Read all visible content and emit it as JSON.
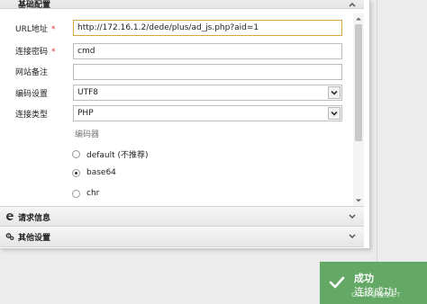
{
  "top_panel": {
    "title": "基础配置"
  },
  "form": {
    "url": {
      "label": "URL地址",
      "required_mark": "*",
      "value": "http://172.16.1.2/dede/plus/ad_js.php?aid=1"
    },
    "password": {
      "label": "连接密码",
      "required_mark": "*",
      "value": "cmd"
    },
    "remark": {
      "label": "网站备注",
      "value": ""
    },
    "encoding": {
      "label": "编码设置",
      "value": "UTF8"
    },
    "conn_type": {
      "label": "连接类型",
      "value": "PHP"
    },
    "encoder": {
      "legend": "编码器",
      "options": [
        {
          "label": "default (不推荐)",
          "selected": false
        },
        {
          "label": "base64",
          "selected": true
        },
        {
          "label": "chr",
          "selected": false
        }
      ]
    }
  },
  "panels": [
    {
      "title": "请求信息",
      "icon": "edge-icon"
    },
    {
      "title": "其他设置",
      "icon": "gears-icon"
    }
  ],
  "toast": {
    "title": "成功",
    "message": "连接成功!",
    "color": "#63a865"
  },
  "watermark": "CSDN @植物军T"
}
